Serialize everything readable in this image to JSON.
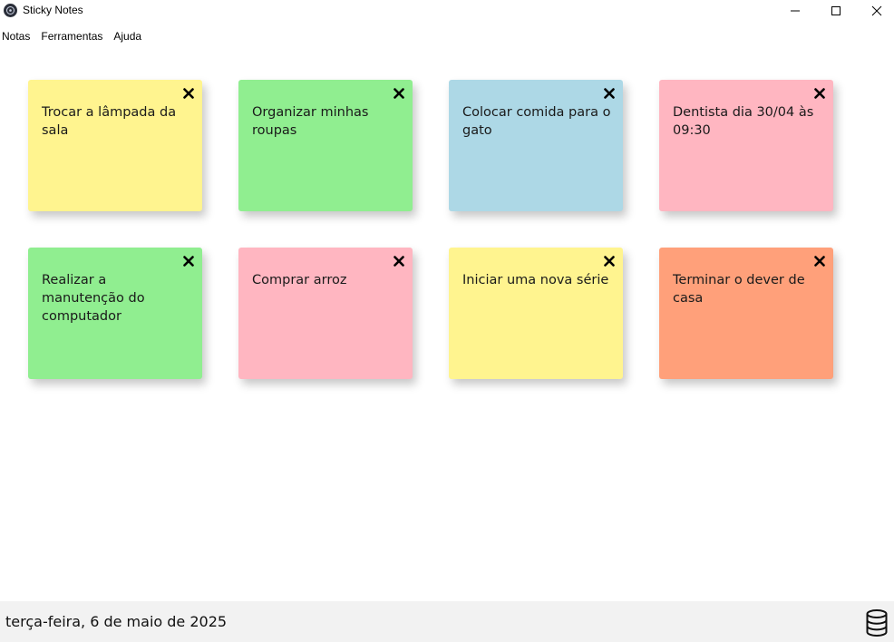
{
  "window": {
    "title": "Sticky Notes",
    "icon": "app-icon"
  },
  "menu": {
    "items": [
      {
        "label": "Notas"
      },
      {
        "label": "Ferramentas"
      },
      {
        "label": "Ajuda"
      }
    ]
  },
  "notes": [
    {
      "text": "Trocar a lâmpada da sala",
      "color": "#fff48f"
    },
    {
      "text": "Organizar minhas roupas",
      "color": "#90ee90"
    },
    {
      "text": "Colocar comida para o gato",
      "color": "#add8e6"
    },
    {
      "text": "Dentista dia 30/04 às 09:30",
      "color": "#ffb6c1"
    },
    {
      "text": "Realizar a manutenção do computador",
      "color": "#90ee90"
    },
    {
      "text": "Comprar arroz",
      "color": "#ffb6c1"
    },
    {
      "text": "Iniciar uma nova série",
      "color": "#fff48f"
    },
    {
      "text": "Terminar o dever de casa",
      "color": "#ffa07a"
    }
  ],
  "status": {
    "date": "terça-feira, 6 de maio de 2025",
    "icon": "database-icon"
  }
}
